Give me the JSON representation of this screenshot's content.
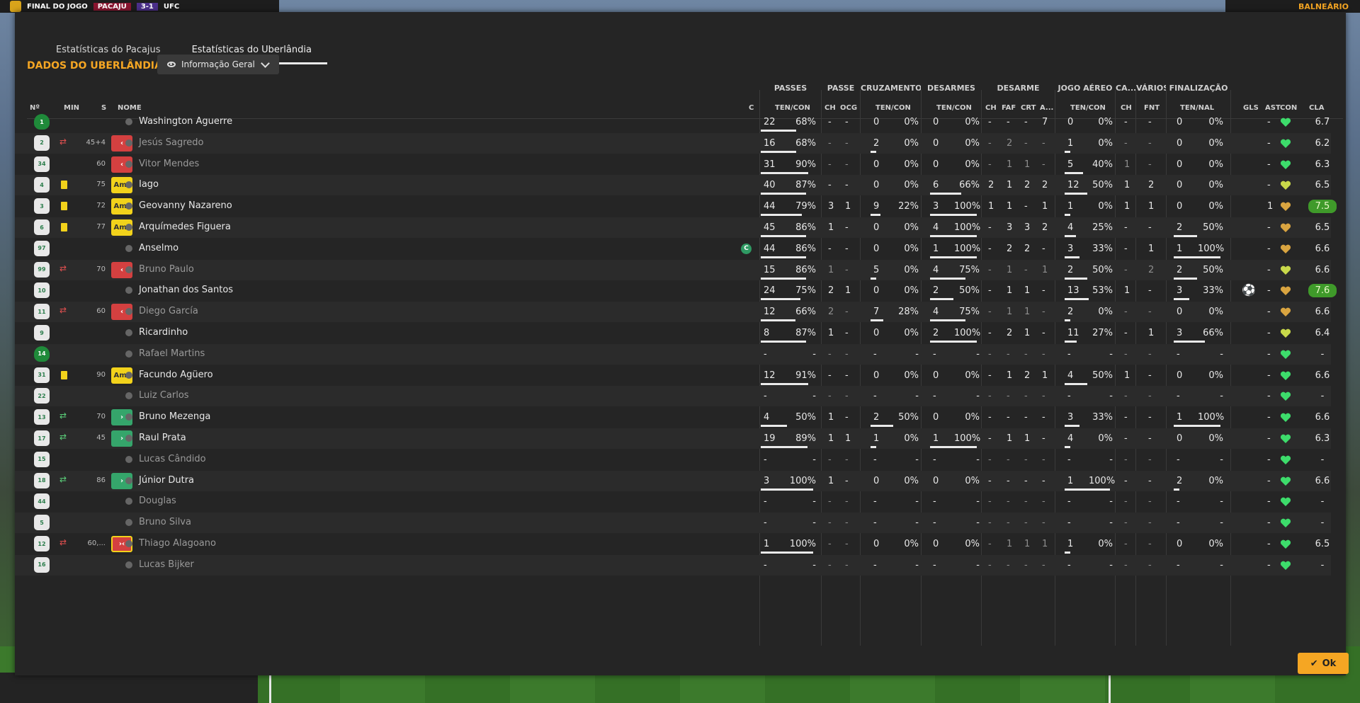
{
  "topbar": {
    "final_label": "FINAL DO JOGO",
    "home_abbr": "PACAJU",
    "score": "3-1",
    "away_abbr": "UFC",
    "right_label": "BALNEÁRIO"
  },
  "tabs": [
    {
      "label": "Estatísticas do Pacajus",
      "active": false
    },
    {
      "label": "Estatísticas do Uberlândia",
      "active": true
    }
  ],
  "section_title": "DADOS DO UBERLÂNDIA",
  "view_dropdown": {
    "label": "Informação Geral"
  },
  "group_headers": [
    "PASSES",
    "PASSE",
    "CRUZAMENTOS",
    "DESARMES",
    "DESARME",
    "JOGO AÉREO",
    "CA...",
    "VÁRIOS",
    "FINALIZAÇÃO"
  ],
  "columns": {
    "num": "Nº",
    "min": "MIN",
    "s": "S",
    "name": "NOME",
    "c": "C",
    "passes": "TEN/CON",
    "passe_ch": "CH",
    "passe_ocg": "OCG",
    "cruz": "TEN/CON",
    "desarmes": "TEN/CON",
    "des_ch": "CH",
    "des_faf": "FAF",
    "des_crt": "CRT",
    "des_a": "A...",
    "aereo": "TEN/CON",
    "ca_ch": "CH",
    "var_fnt": "FNT",
    "fin": "TEN/NAL",
    "gls": "GLS",
    "ast": "AST",
    "con": "CON",
    "cla": "CLA"
  },
  "players": [
    {
      "num": "1",
      "gk": true,
      "ev": "",
      "min": "",
      "s": "",
      "s_label": "",
      "name": "Washington Aguerre",
      "dim": false,
      "cap": false,
      "pt": "22",
      "pc": "68%",
      "pf": 0.68,
      "ch": "-",
      "ocg": "-",
      "ct": "0",
      "cc": "0%",
      "cf": 0,
      "dt": "0",
      "dc": "0%",
      "df": 0,
      "d1": "-",
      "d2": "-",
      "d3": "-",
      "d4": "7",
      "at": "0",
      "ac": "0%",
      "af": 0,
      "cach": "-",
      "fnt": "-",
      "ft": "0",
      "fc": "0%",
      "ff": 0,
      "gls": "",
      "ast": "-",
      "heart": "#3ddc6b",
      "cla": "6.7",
      "hi": false
    },
    {
      "num": "2",
      "gk": false,
      "ev": "subred",
      "min": "45+4",
      "s": "out",
      "s_label": "‹",
      "name": "Jesús Sagredo",
      "dim": true,
      "cap": false,
      "pt": "16",
      "pc": "68%",
      "pf": 0.68,
      "ch": "-",
      "ocg": "-",
      "ct": "2",
      "cc": "0%",
      "cf": 0,
      "dt": "0",
      "dc": "0%",
      "df": 0,
      "d1": "-",
      "d2": "2",
      "d3": "-",
      "d4": "-",
      "at": "1",
      "ac": "0%",
      "af": 0,
      "cach": "-",
      "fnt": "-",
      "ft": "0",
      "fc": "0%",
      "ff": 0,
      "gls": "",
      "ast": "-",
      "heart": "#3ddc6b",
      "cla": "6.2",
      "hi": false
    },
    {
      "num": "34",
      "gk": false,
      "ev": "",
      "min": "60",
      "s": "out",
      "s_label": "‹",
      "name": "Vitor Mendes",
      "dim": true,
      "cap": false,
      "pt": "31",
      "pc": "90%",
      "pf": 0.9,
      "ch": "-",
      "ocg": "-",
      "ct": "0",
      "cc": "0%",
      "cf": 0,
      "dt": "0",
      "dc": "0%",
      "df": 0,
      "d1": "-",
      "d2": "1",
      "d3": "1",
      "d4": "-",
      "at": "5",
      "ac": "40%",
      "af": 0.4,
      "cach": "1",
      "fnt": "-",
      "ft": "0",
      "fc": "0%",
      "ff": 0,
      "gls": "",
      "ast": "-",
      "heart": "#3ddc6b",
      "cla": "6.3",
      "hi": false
    },
    {
      "num": "4",
      "gk": false,
      "ev": "yellow",
      "min": "75",
      "s": "amr",
      "s_label": "Amr",
      "name": "Iago",
      "dim": false,
      "cap": false,
      "pt": "40",
      "pc": "87%",
      "pf": 0.87,
      "ch": "-",
      "ocg": "-",
      "ct": "0",
      "cc": "0%",
      "cf": 0,
      "dt": "6",
      "dc": "66%",
      "df": 0.66,
      "d1": "2",
      "d2": "1",
      "d3": "2",
      "d4": "2",
      "at": "12",
      "ac": "50%",
      "af": 0.5,
      "cach": "1",
      "fnt": "2",
      "ft": "0",
      "fc": "0%",
      "ff": 0,
      "gls": "",
      "ast": "-",
      "heart": "#c9d94a",
      "cla": "6.5",
      "hi": false
    },
    {
      "num": "3",
      "gk": false,
      "ev": "yellow",
      "min": "72",
      "s": "amr",
      "s_label": "Amr",
      "name": "Geovanny Nazareno",
      "dim": false,
      "cap": false,
      "pt": "44",
      "pc": "79%",
      "pf": 0.79,
      "ch": "3",
      "ocg": "1",
      "ct": "9",
      "cc": "22%",
      "cf": 0.22,
      "dt": "3",
      "dc": "100%",
      "df": 1,
      "d1": "1",
      "d2": "1",
      "d3": "-",
      "d4": "1",
      "at": "1",
      "ac": "0%",
      "af": 0,
      "cach": "1",
      "fnt": "1",
      "ft": "0",
      "fc": "0%",
      "ff": 0,
      "gls": "",
      "ast": "1",
      "heart": "#d9a440",
      "cla": "7.5",
      "hi": true
    },
    {
      "num": "6",
      "gk": false,
      "ev": "yellow",
      "min": "77",
      "s": "amr",
      "s_label": "Amr",
      "name": "Arquímedes Figuera",
      "dim": false,
      "cap": false,
      "pt": "45",
      "pc": "86%",
      "pf": 0.86,
      "ch": "1",
      "ocg": "-",
      "ct": "0",
      "cc": "0%",
      "cf": 0,
      "dt": "4",
      "dc": "100%",
      "df": 1,
      "d1": "-",
      "d2": "3",
      "d3": "3",
      "d4": "2",
      "at": "4",
      "ac": "25%",
      "af": 0.25,
      "cach": "-",
      "fnt": "-",
      "ft": "2",
      "fc": "50%",
      "ff": 0.5,
      "gls": "",
      "ast": "-",
      "heart": "#d9a440",
      "cla": "6.5",
      "hi": false
    },
    {
      "num": "97",
      "gk": false,
      "ev": "",
      "min": "",
      "s": "",
      "s_label": "",
      "name": "Anselmo",
      "dim": false,
      "cap": true,
      "cap_label": "C",
      "pt": "44",
      "pc": "86%",
      "pf": 0.86,
      "ch": "-",
      "ocg": "-",
      "ct": "0",
      "cc": "0%",
      "cf": 0,
      "dt": "1",
      "dc": "100%",
      "df": 1,
      "d1": "-",
      "d2": "2",
      "d3": "2",
      "d4": "-",
      "at": "3",
      "ac": "33%",
      "af": 0.33,
      "cach": "-",
      "fnt": "1",
      "ft": "1",
      "fc": "100%",
      "ff": 1,
      "gls": "",
      "ast": "-",
      "heart": "#d9a440",
      "cla": "6.6",
      "hi": false
    },
    {
      "num": "99",
      "gk": false,
      "ev": "subred",
      "min": "70",
      "s": "out",
      "s_label": "‹",
      "name": "Bruno Paulo",
      "dim": true,
      "cap": false,
      "pt": "15",
      "pc": "86%",
      "pf": 0.86,
      "ch": "1",
      "ocg": "-",
      "ct": "5",
      "cc": "0%",
      "cf": 0,
      "dt": "4",
      "dc": "75%",
      "df": 0.75,
      "d1": "-",
      "d2": "1",
      "d3": "-",
      "d4": "1",
      "at": "2",
      "ac": "50%",
      "af": 0.5,
      "cach": "-",
      "fnt": "2",
      "ft": "2",
      "fc": "50%",
      "ff": 0.5,
      "gls": "",
      "ast": "-",
      "heart": "#c9d94a",
      "cla": "6.6",
      "hi": false
    },
    {
      "num": "10",
      "gk": false,
      "ev": "",
      "min": "",
      "s": "",
      "s_label": "",
      "name": "Jonathan dos Santos",
      "dim": false,
      "cap": false,
      "pt": "24",
      "pc": "75%",
      "pf": 0.75,
      "ch": "2",
      "ocg": "1",
      "ct": "0",
      "cc": "0%",
      "cf": 0,
      "dt": "2",
      "dc": "50%",
      "df": 0.5,
      "d1": "-",
      "d2": "1",
      "d3": "1",
      "d4": "-",
      "at": "13",
      "ac": "53%",
      "af": 0.53,
      "cach": "1",
      "fnt": "-",
      "ft": "3",
      "fc": "33%",
      "ff": 0.33,
      "gls": "⚽",
      "ast": "-",
      "heart": "#d9a440",
      "cla": "7.6",
      "hi": true
    },
    {
      "num": "11",
      "gk": false,
      "ev": "subred",
      "min": "60",
      "s": "out",
      "s_label": "‹",
      "name": "Diego García",
      "dim": true,
      "cap": false,
      "pt": "12",
      "pc": "66%",
      "pf": 0.66,
      "ch": "2",
      "ocg": "-",
      "ct": "7",
      "cc": "28%",
      "cf": 0.28,
      "dt": "4",
      "dc": "75%",
      "df": 0.75,
      "d1": "-",
      "d2": "1",
      "d3": "1",
      "d4": "-",
      "at": "2",
      "ac": "0%",
      "af": 0,
      "cach": "-",
      "fnt": "-",
      "ft": "0",
      "fc": "0%",
      "ff": 0,
      "gls": "",
      "ast": "-",
      "heart": "#d9a440",
      "cla": "6.6",
      "hi": false
    },
    {
      "num": "9",
      "gk": false,
      "ev": "",
      "min": "",
      "s": "",
      "s_label": "",
      "name": "Ricardinho",
      "dim": false,
      "cap": false,
      "pt": "8",
      "pc": "87%",
      "pf": 0.87,
      "ch": "1",
      "ocg": "-",
      "ct": "0",
      "cc": "0%",
      "cf": 0,
      "dt": "2",
      "dc": "100%",
      "df": 1,
      "d1": "-",
      "d2": "2",
      "d3": "1",
      "d4": "-",
      "at": "11",
      "ac": "27%",
      "af": 0.27,
      "cach": "-",
      "fnt": "1",
      "ft": "3",
      "fc": "66%",
      "ff": 0.66,
      "gls": "",
      "ast": "-",
      "heart": "#c9d94a",
      "cla": "6.4",
      "hi": false
    },
    {
      "num": "14",
      "gk": true,
      "ev": "",
      "min": "",
      "s": "",
      "s_label": "",
      "name": "Rafael Martins",
      "dim": true,
      "cap": false,
      "pt": "-",
      "pc": "-",
      "pf": 0,
      "ch": "-",
      "ocg": "-",
      "ct": "-",
      "cc": "-",
      "cf": 0,
      "dt": "-",
      "dc": "-",
      "df": 0,
      "d1": "-",
      "d2": "-",
      "d3": "-",
      "d4": "-",
      "at": "-",
      "ac": "-",
      "af": 0,
      "cach": "-",
      "fnt": "-",
      "ft": "-",
      "fc": "-",
      "ff": 0,
      "gls": "",
      "ast": "-",
      "heart": "#3ddc6b",
      "cla": "-",
      "hi": false
    },
    {
      "num": "31",
      "gk": false,
      "ev": "yellow",
      "min": "90",
      "s": "amr",
      "s_label": "Amr",
      "name": "Facundo Agüero",
      "dim": false,
      "cap": false,
      "pt": "12",
      "pc": "91%",
      "pf": 0.91,
      "ch": "-",
      "ocg": "-",
      "ct": "0",
      "cc": "0%",
      "cf": 0,
      "dt": "0",
      "dc": "0%",
      "df": 0,
      "d1": "-",
      "d2": "1",
      "d3": "2",
      "d4": "1",
      "at": "4",
      "ac": "50%",
      "af": 0.5,
      "cach": "1",
      "fnt": "-",
      "ft": "0",
      "fc": "0%",
      "ff": 0,
      "gls": "",
      "ast": "-",
      "heart": "#3ddc6b",
      "cla": "6.6",
      "hi": false
    },
    {
      "num": "22",
      "gk": false,
      "ev": "",
      "min": "",
      "s": "",
      "s_label": "",
      "name": "Luiz Carlos",
      "dim": true,
      "cap": false,
      "pt": "-",
      "pc": "-",
      "pf": 0,
      "ch": "-",
      "ocg": "-",
      "ct": "-",
      "cc": "-",
      "cf": 0,
      "dt": "-",
      "dc": "-",
      "df": 0,
      "d1": "-",
      "d2": "-",
      "d3": "-",
      "d4": "-",
      "at": "-",
      "ac": "-",
      "af": 0,
      "cach": "-",
      "fnt": "-",
      "ft": "-",
      "fc": "-",
      "ff": 0,
      "gls": "",
      "ast": "-",
      "heart": "#3ddc6b",
      "cla": "-",
      "hi": false
    },
    {
      "num": "13",
      "gk": false,
      "ev": "sub",
      "min": "70",
      "s": "in",
      "s_label": "›",
      "name": "Bruno Mezenga",
      "dim": false,
      "cap": false,
      "pt": "4",
      "pc": "50%",
      "pf": 0.5,
      "ch": "1",
      "ocg": "-",
      "ct": "2",
      "cc": "50%",
      "cf": 0.5,
      "dt": "0",
      "dc": "0%",
      "df": 0,
      "d1": "-",
      "d2": "-",
      "d3": "-",
      "d4": "-",
      "at": "3",
      "ac": "33%",
      "af": 0.33,
      "cach": "-",
      "fnt": "-",
      "ft": "1",
      "fc": "100%",
      "ff": 1,
      "gls": "",
      "ast": "-",
      "heart": "#3ddc6b",
      "cla": "6.6",
      "hi": false
    },
    {
      "num": "17",
      "gk": false,
      "ev": "sub",
      "min": "45",
      "s": "in",
      "s_label": "›",
      "name": "Raul Prata",
      "dim": false,
      "cap": false,
      "pt": "19",
      "pc": "89%",
      "pf": 0.89,
      "ch": "1",
      "ocg": "1",
      "ct": "1",
      "cc": "0%",
      "cf": 0,
      "dt": "1",
      "dc": "100%",
      "df": 1,
      "d1": "-",
      "d2": "1",
      "d3": "1",
      "d4": "-",
      "at": "4",
      "ac": "0%",
      "af": 0,
      "cach": "-",
      "fnt": "-",
      "ft": "0",
      "fc": "0%",
      "ff": 0,
      "gls": "",
      "ast": "-",
      "heart": "#3ddc6b",
      "cla": "6.3",
      "hi": false
    },
    {
      "num": "15",
      "gk": false,
      "ev": "",
      "min": "",
      "s": "",
      "s_label": "",
      "name": "Lucas Cândido",
      "dim": true,
      "cap": false,
      "pt": "-",
      "pc": "-",
      "pf": 0,
      "ch": "-",
      "ocg": "-",
      "ct": "-",
      "cc": "-",
      "cf": 0,
      "dt": "-",
      "dc": "-",
      "df": 0,
      "d1": "-",
      "d2": "-",
      "d3": "-",
      "d4": "-",
      "at": "-",
      "ac": "-",
      "af": 0,
      "cach": "-",
      "fnt": "-",
      "ft": "-",
      "fc": "-",
      "ff": 0,
      "gls": "",
      "ast": "-",
      "heart": "#3ddc6b",
      "cla": "-",
      "hi": false
    },
    {
      "num": "18",
      "gk": false,
      "ev": "sub",
      "min": "86",
      "s": "in",
      "s_label": "›",
      "name": "Júnior Dutra",
      "dim": false,
      "cap": false,
      "pt": "3",
      "pc": "100%",
      "pf": 1,
      "ch": "1",
      "ocg": "-",
      "ct": "0",
      "cc": "0%",
      "cf": 0,
      "dt": "0",
      "dc": "0%",
      "df": 0,
      "d1": "-",
      "d2": "-",
      "d3": "-",
      "d4": "-",
      "at": "1",
      "ac": "100%",
      "af": 1,
      "cach": "-",
      "fnt": "-",
      "ft": "2",
      "fc": "0%",
      "ff": 0,
      "gls": "",
      "ast": "-",
      "heart": "#3ddc6b",
      "cla": "6.6",
      "hi": false
    },
    {
      "num": "44",
      "gk": false,
      "ev": "",
      "min": "",
      "s": "",
      "s_label": "",
      "name": "Douglas",
      "dim": true,
      "cap": false,
      "pt": "-",
      "pc": "-",
      "pf": 0,
      "ch": "-",
      "ocg": "-",
      "ct": "-",
      "cc": "-",
      "cf": 0,
      "dt": "-",
      "dc": "-",
      "df": 0,
      "d1": "-",
      "d2": "-",
      "d3": "-",
      "d4": "-",
      "at": "-",
      "ac": "-",
      "af": 0,
      "cach": "-",
      "fnt": "-",
      "ft": "-",
      "fc": "-",
      "ff": 0,
      "gls": "",
      "ast": "-",
      "heart": "#3ddc6b",
      "cla": "-",
      "hi": false
    },
    {
      "num": "5",
      "gk": false,
      "ev": "",
      "min": "",
      "s": "",
      "s_label": "",
      "name": "Bruno Silva",
      "dim": true,
      "cap": false,
      "pt": "-",
      "pc": "-",
      "pf": 0,
      "ch": "-",
      "ocg": "-",
      "ct": "-",
      "cc": "-",
      "cf": 0,
      "dt": "-",
      "dc": "-",
      "df": 0,
      "d1": "-",
      "d2": "-",
      "d3": "-",
      "d4": "-",
      "at": "-",
      "ac": "-",
      "af": 0,
      "cach": "-",
      "fnt": "-",
      "ft": "-",
      "fc": "-",
      "ff": 0,
      "gls": "",
      "ast": "-",
      "heart": "#3ddc6b",
      "cla": "-",
      "hi": false
    },
    {
      "num": "12",
      "gk": false,
      "ev": "subred",
      "min": "60,...",
      "s": "out",
      "s_label": "›‹",
      "name": "Thiago Alagoano",
      "dim": true,
      "cap": false,
      "border": true,
      "pt": "1",
      "pc": "100%",
      "pf": 1,
      "ch": "-",
      "ocg": "-",
      "ct": "0",
      "cc": "0%",
      "cf": 0,
      "dt": "0",
      "dc": "0%",
      "df": 0,
      "d1": "-",
      "d2": "1",
      "d3": "1",
      "d4": "1",
      "at": "1",
      "ac": "0%",
      "af": 0,
      "cach": "-",
      "fnt": "-",
      "ft": "0",
      "fc": "0%",
      "ff": 0,
      "gls": "",
      "ast": "-",
      "heart": "#3ddc6b",
      "cla": "6.5",
      "hi": false
    },
    {
      "num": "16",
      "gk": false,
      "ev": "",
      "min": "",
      "s": "",
      "s_label": "",
      "name": "Lucas Bijker",
      "dim": true,
      "cap": false,
      "pt": "-",
      "pc": "-",
      "pf": 0,
      "ch": "-",
      "ocg": "-",
      "ct": "-",
      "cc": "-",
      "cf": 0,
      "dt": "-",
      "dc": "-",
      "df": 0,
      "d1": "-",
      "d2": "-",
      "d3": "-",
      "d4": "-",
      "at": "-",
      "ac": "-",
      "af": 0,
      "cach": "-",
      "fnt": "-",
      "ft": "-",
      "fc": "-",
      "ff": 0,
      "gls": "",
      "ast": "-",
      "heart": "#3ddc6b",
      "cla": "-",
      "hi": false
    }
  ],
  "ok_button": {
    "label": "Ok"
  },
  "colors": {
    "accent": "#f5a623",
    "panel": "#252525",
    "highlight_rating": "#3f9a2a"
  }
}
